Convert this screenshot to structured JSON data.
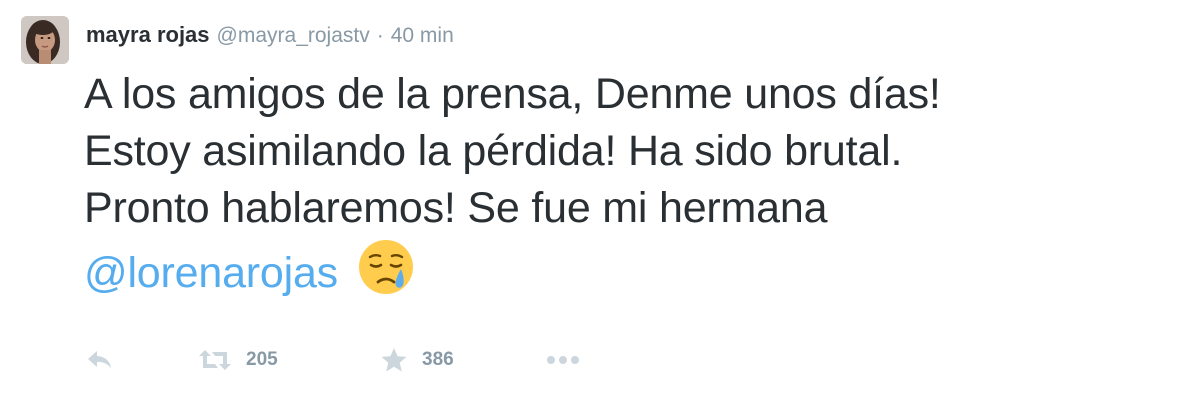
{
  "user": {
    "fullname": "mayra rojas",
    "handle": "@mayra_rojastv",
    "separator": "·",
    "time": "40 min"
  },
  "tweet": {
    "lines": [
      "A los amigos de la prensa, Denme unos días!",
      "Estoy asimilando la pérdida! Ha sido brutal.",
      "Pronto hablaremos! Se fue mi hermana"
    ],
    "mention": "@lorenarojas",
    "emoji": "sad-relieved-face-with-tear"
  },
  "actions": {
    "reply_icon": "reply-icon",
    "retweet_icon": "retweet-icon",
    "retweet_count": "205",
    "favorite_icon": "star-icon",
    "favorite_count": "386",
    "more_icon": "more-dots-icon"
  },
  "colors": {
    "text": "#292f33",
    "muted": "#8899a6",
    "link": "#55acee",
    "icon": "#ccd6dd"
  }
}
